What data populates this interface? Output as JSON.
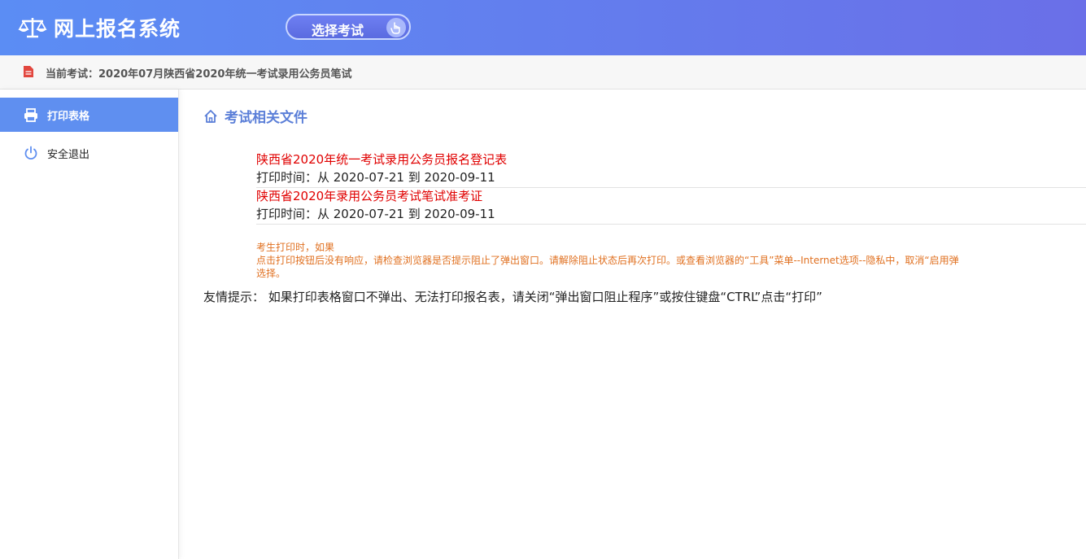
{
  "header": {
    "app_title": "网上报名系统",
    "select_exam_label": "选择考试",
    "background_gradient": [
      "#5b8df4",
      "#6a6fe8"
    ]
  },
  "notice": {
    "current_exam_text": "当前考试：2020年07月陕西省2020年统一考试录用公务员笔试"
  },
  "sidebar": {
    "items": [
      {
        "label": "打印表格",
        "icon": "printer-icon",
        "active": true
      },
      {
        "label": "安全退出",
        "icon": "power-icon",
        "active": false
      }
    ],
    "active_color": "#5f8ff0"
  },
  "main": {
    "section_title": "考试相关文件",
    "files": [
      {
        "title": "陕西省2020年统一考试录用公务员报名登记表",
        "print_time": "打印时间：从 2020-07-21 到 2020-09-11"
      },
      {
        "title": "陕西省2020年录用公务员考试笔试准考证",
        "print_time": "打印时间：从 2020-07-21 到 2020-09-11"
      }
    ],
    "warning_lines": [
      "考生打印时，如果",
      "点击打印按钮后没有响应，请检查浏览器是否提示阻止了弹出窗口。请解除阻止状态后再次打印。或查看浏览器的“工具”菜单--Internet选项--隐私中，取消“启用弹",
      "选择。"
    ],
    "tip": "友情提示： 如果打印表格窗口不弹出、无法打印报名表，请关闭“弹出窗口阻止程序”或按住键盘“CTRL”点击“打印”",
    "link_color": "#e00000",
    "warning_color": "#e07020"
  }
}
